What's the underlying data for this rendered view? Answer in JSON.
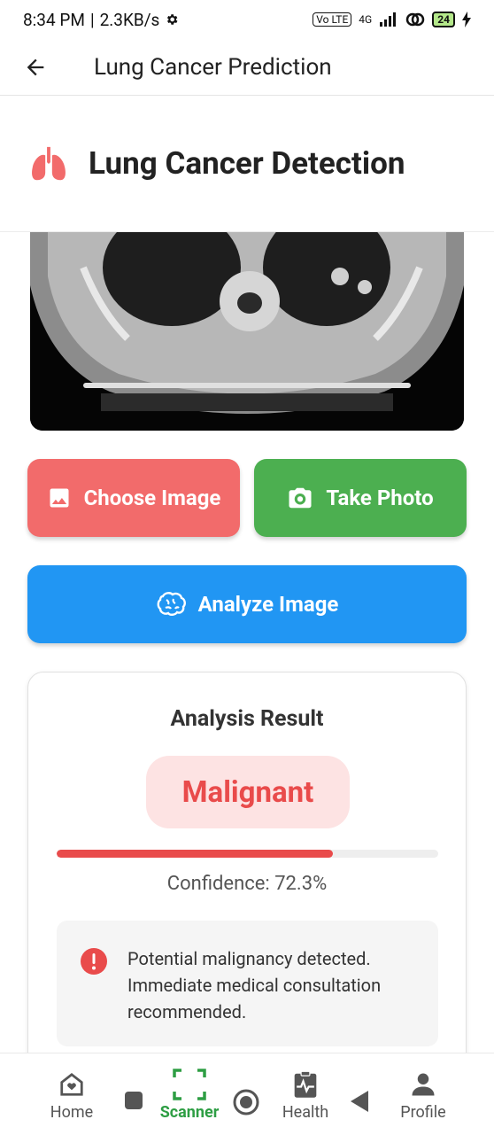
{
  "status_bar": {
    "time": "8:34 PM",
    "speed": "2.3KB/s",
    "volte": "Vo LTE",
    "network": "4G",
    "battery": "24"
  },
  "app_bar": {
    "title": "Lung Cancer Prediction"
  },
  "hero": {
    "title": "Lung Cancer Detection",
    "icon": "lungs-icon",
    "icon_color": "#f26b6b"
  },
  "actions": {
    "choose_label": "Choose Image",
    "photo_label": "Take Photo",
    "analyze_label": "Analyze Image",
    "choose_color": "#f26b6b",
    "photo_color": "#4caf50",
    "analyze_color": "#2196f3"
  },
  "result": {
    "title": "Analysis Result",
    "label": "Malignant",
    "confidence_text": "Confidence: 72.3%",
    "confidence_value": 0.723,
    "message": "Potential malignancy detected. Immediate medical consultation recommended.",
    "accent_color": "#e94b4b"
  },
  "bottom_nav": {
    "items": [
      {
        "label": "Home",
        "icon": "home-icon"
      },
      {
        "label": "Scanner",
        "icon": "scanner-icon"
      },
      {
        "label": "Health",
        "icon": "health-icon"
      },
      {
        "label": "Profile",
        "icon": "profile-icon"
      }
    ],
    "active": "Scanner",
    "active_color": "#2e9e44"
  }
}
